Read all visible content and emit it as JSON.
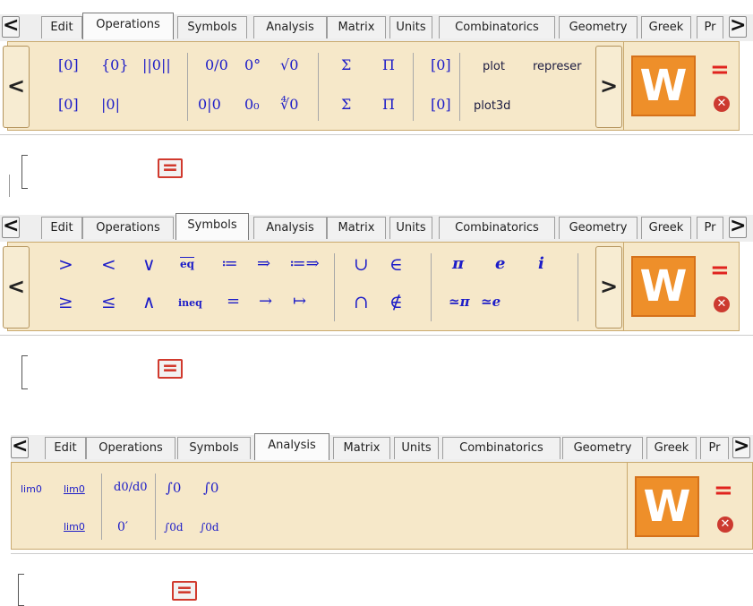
{
  "panels": [
    {
      "active_tab": "Operations",
      "tabs": [
        "Edit",
        "Operations",
        "Symbols",
        "Analysis",
        "Matrix",
        "Units",
        "Combinatorics",
        "Geometry",
        "Greek",
        "Pr"
      ],
      "buttons": [
        "[0]",
        "{0}",
        "||0||",
        "[0]",
        "|0|",
        "0/0",
        "0°",
        "√0",
        "0|0",
        "0₀",
        "∜0",
        "Σ",
        "Π",
        "Σ̄",
        "Π̄",
        "[0]",
        "[0]",
        "plot",
        "represer",
        "plot3d"
      ]
    },
    {
      "active_tab": "Symbols",
      "tabs": [
        "Edit",
        "Operations",
        "Symbols",
        "Analysis",
        "Matrix",
        "Units",
        "Combinatorics",
        "Geometry",
        "Greek",
        "Pr"
      ],
      "buttons": [
        ">",
        "<",
        "∨",
        "eq",
        "≔",
        "⇒",
        "≔⇒",
        "≥",
        "≤",
        "∧",
        "ineq",
        "=",
        "→",
        "↦",
        "∪",
        "∈",
        "∩",
        "∉",
        "π",
        "e",
        "i",
        "≃π",
        "≃e"
      ]
    },
    {
      "active_tab": "Analysis",
      "tabs": [
        "Edit",
        "Operations",
        "Symbols",
        "Analysis",
        "Matrix",
        "Units",
        "Combinatorics",
        "Geometry",
        "Greek",
        "Pr"
      ],
      "buttons": [
        "lim0",
        "lim0",
        "lim0",
        "d0/d0",
        "0′",
        "∫0",
        "∫0",
        "∫0d",
        "∫0d"
      ]
    }
  ],
  "nav": {
    "left": "<",
    "right": ">"
  },
  "logo": {
    "letter": "W",
    "equal": "=",
    "close": "✕",
    "eval": "="
  },
  "colors": {
    "toolbar_bg": "#f6e8c9",
    "logo_orange": "#ee8f2a",
    "symbol_blue": "#1c1cc8",
    "eval_red": "#d13a2e"
  }
}
